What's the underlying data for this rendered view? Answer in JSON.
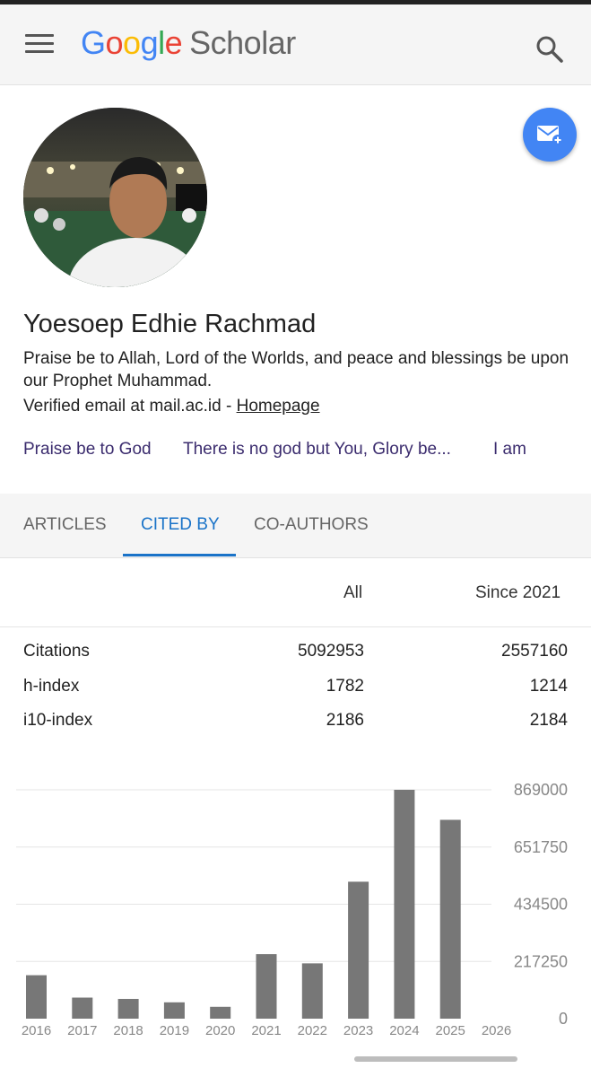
{
  "header": {
    "logo_google": "Google",
    "logo_scholar": "Scholar"
  },
  "profile": {
    "name": "Yoesoep Edhie Rachmad",
    "affiliation": "Praise be to Allah, Lord of the Worlds, and peace and blessings be upon our Prophet Muhammad.",
    "verified_email": "Verified email at mail.ac.id - ",
    "homepage_label": "Homepage",
    "interests": [
      "Praise be to God",
      "There is no god but You, Glory be...",
      "I am"
    ]
  },
  "tabs": [
    "ARTICLES",
    "CITED BY",
    "CO-AUTHORS"
  ],
  "active_tab": "CITED BY",
  "stats": {
    "headers": [
      "All",
      "Since 2021"
    ],
    "rows": [
      {
        "label": "Citations",
        "all": "5092953",
        "since": "2557160"
      },
      {
        "label": "h-index",
        "all": "1782",
        "since": "1214"
      },
      {
        "label": "i10-index",
        "all": "2186",
        "since": "2184"
      }
    ]
  },
  "colors": {
    "accent": "#1a73c8",
    "fab": "#4285f4",
    "bar": "#777777",
    "interest": "#3b2c6e"
  },
  "icons": [
    "menu-icon",
    "search-icon",
    "mail-add-icon"
  ],
  "chart_data": {
    "type": "bar",
    "categories": [
      "2016",
      "2017",
      "2018",
      "2019",
      "2020",
      "2021",
      "2022",
      "2023",
      "2024",
      "2025",
      "2026"
    ],
    "values": [
      165000,
      80000,
      75000,
      62000,
      45000,
      245000,
      210000,
      520000,
      869000,
      755000,
      0
    ],
    "y_ticks": [
      "0",
      "217250",
      "434500",
      "651750",
      "869000"
    ],
    "ylim": [
      0,
      869000
    ],
    "grid": true
  }
}
